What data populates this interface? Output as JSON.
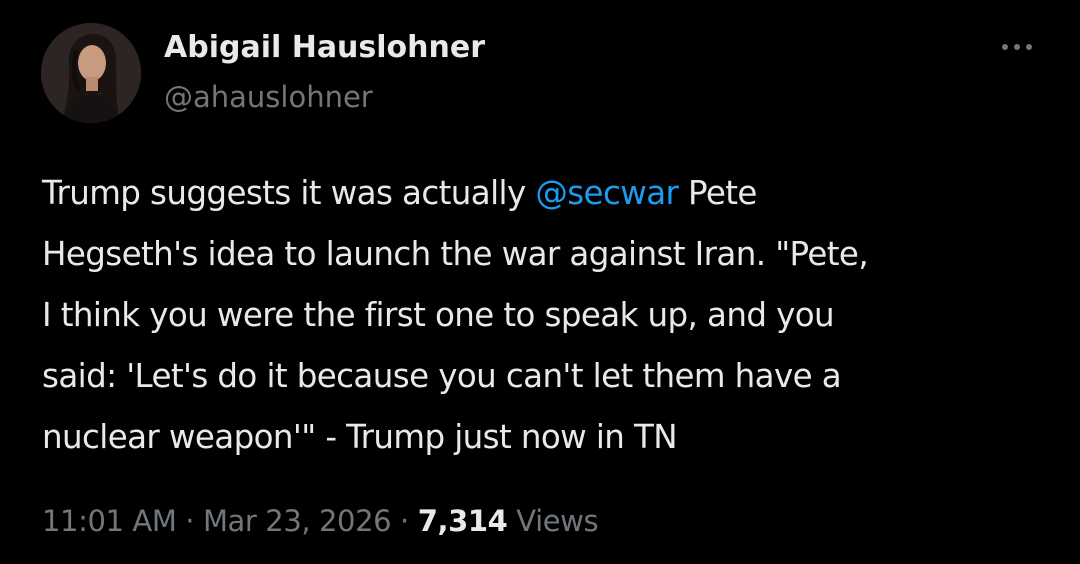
{
  "author": {
    "display_name": "Abigail Hauslohner",
    "handle": "@ahauslohner"
  },
  "more_icon": "more-horizontal-icon",
  "tweet": {
    "line1_pre": "Trump suggests it was actually ",
    "mention": "@secwar",
    "line1_post": " Pete",
    "line2": "Hegseth's idea to launch the war against Iran. \"Pete,",
    "line3": "I think you were the first one to speak up, and you",
    "line4": "said: 'Let's do it because you can't let them have a",
    "line5": "nuclear weapon'\" - Trump just now in TN"
  },
  "meta": {
    "time": "11:01 AM",
    "separator": "·",
    "date": "Mar 23, 2026",
    "views_count": "7,314",
    "views_label": "Views"
  },
  "colors": {
    "background": "#000000",
    "text": "#e7e9ea",
    "secondary": "#71767b",
    "accent": "#1d9bf0"
  }
}
